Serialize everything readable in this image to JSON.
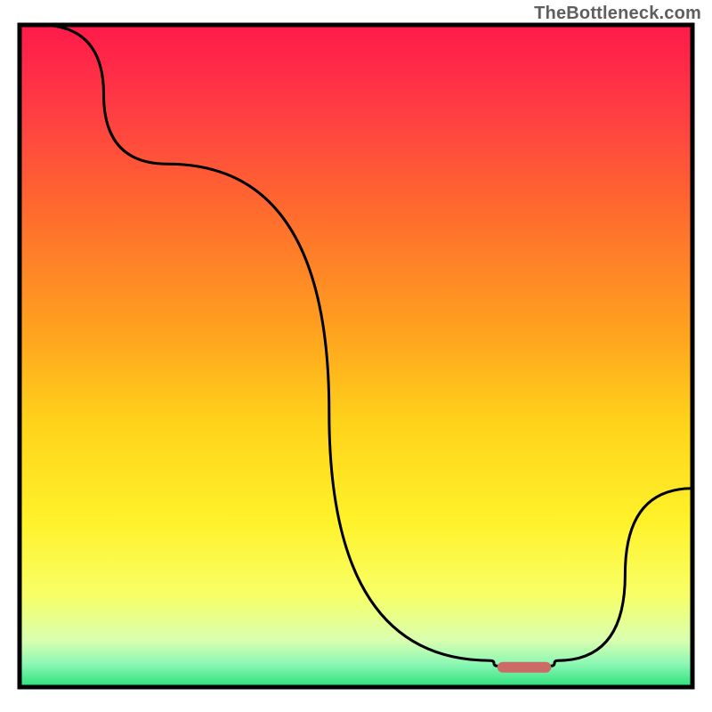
{
  "watermark": "TheBottleneck.com",
  "chart_data": {
    "type": "line",
    "title": "",
    "xlabel": "",
    "ylabel": "",
    "xlim": [
      0,
      100
    ],
    "ylim": [
      0,
      100
    ],
    "series": [
      {
        "name": "curve",
        "points": [
          {
            "x": 3,
            "y": 100
          },
          {
            "x": 22,
            "y": 79
          },
          {
            "x": 70,
            "y": 4
          },
          {
            "x": 71,
            "y": 3.2
          },
          {
            "x": 75,
            "y": 3
          },
          {
            "x": 79,
            "y": 3.2
          },
          {
            "x": 80,
            "y": 4
          },
          {
            "x": 100,
            "y": 30
          }
        ]
      }
    ],
    "marker": {
      "x_start": 71,
      "x_end": 79,
      "y": 3,
      "color": "#cc6a66"
    },
    "gradient_stops": [
      {
        "offset": 0.0,
        "color": "#ff1a4a"
      },
      {
        "offset": 0.12,
        "color": "#ff3a44"
      },
      {
        "offset": 0.28,
        "color": "#ff6a2e"
      },
      {
        "offset": 0.45,
        "color": "#ff9e1f"
      },
      {
        "offset": 0.6,
        "color": "#ffd21a"
      },
      {
        "offset": 0.75,
        "color": "#fff22a"
      },
      {
        "offset": 0.86,
        "color": "#f8ff66"
      },
      {
        "offset": 0.93,
        "color": "#d8ffb0"
      },
      {
        "offset": 0.965,
        "color": "#8cf7b4"
      },
      {
        "offset": 1.0,
        "color": "#2be07a"
      }
    ]
  }
}
